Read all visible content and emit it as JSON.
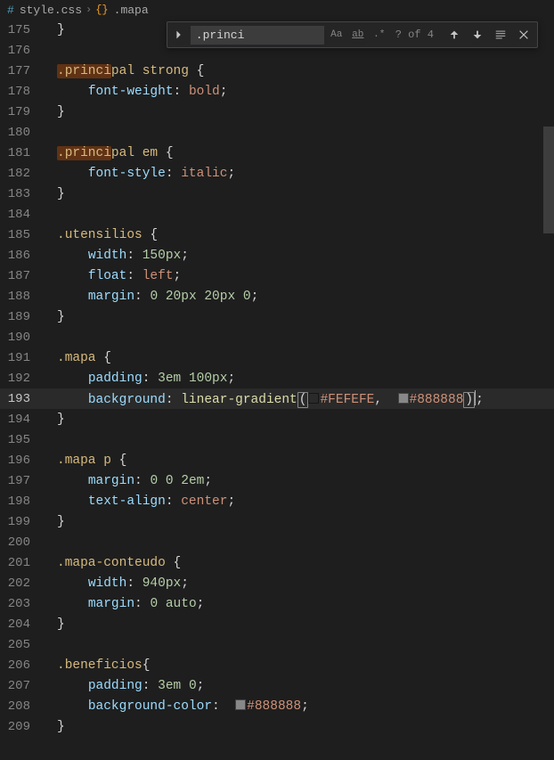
{
  "breadcrumbs": {
    "file_icon": "#",
    "file": "style.css",
    "symbol_icon": "{}",
    "symbol": ".mapa"
  },
  "find": {
    "value": ".princi",
    "opt_case": "Aa",
    "opt_word": "ab",
    "opt_regex": ".*",
    "count": "? of 4"
  },
  "gutter_start": 175,
  "code": {
    "l175": "}",
    "l177_sel_hl": ".princi",
    "l177_sel_rest": "pal",
    "l177_kw": "strong",
    "l177_brace": " {",
    "l178_prop": "font-weight",
    "l178_val": "bold",
    "l179": "}",
    "l181_sel_hl": ".princi",
    "l181_sel_rest": "pal",
    "l181_kw": "em",
    "l181_brace": " {",
    "l182_prop": "font-style",
    "l182_val": "italic",
    "l183": "}",
    "l185_sel": ".utensilios",
    "l185_brace": " {",
    "l186_prop": "width",
    "l186_val": "150px",
    "l187_prop": "float",
    "l187_val": "left",
    "l188_prop": "margin",
    "l188_v1": "0",
    "l188_v2": "20px",
    "l188_v3": "20px",
    "l188_v4": "0",
    "l189": "}",
    "l191_sel": ".mapa",
    "l191_brace": " {",
    "l192_prop": "padding",
    "l192_v1": "3em",
    "l192_v2": "100px",
    "l193_prop": "background",
    "l193_fn": "linear-gradient",
    "l193_c1": "#FEFEFE",
    "l193_c2": "#888888",
    "l194": "}",
    "l196_sel": ".mapa",
    "l196_kw": "p",
    "l196_brace": " {",
    "l197_prop": "margin",
    "l197_v1": "0",
    "l197_v2": "0",
    "l197_v3": "2em",
    "l198_prop": "text-align",
    "l198_val": "center",
    "l199": "}",
    "l201_sel": ".mapa-conteudo",
    "l201_brace": " {",
    "l202_prop": "width",
    "l202_val": "940px",
    "l203_prop": "margin",
    "l203_v1": "0",
    "l203_v2": "auto",
    "l204": "}",
    "l206_sel": ".beneficios",
    "l206_brace": "{",
    "l207_prop": "padding",
    "l207_v1": "3em",
    "l207_v2": "0",
    "l208_prop": "background-color",
    "l208_c": "#888888",
    "l209": "}"
  },
  "colors": {
    "c1": "#FEFEFE",
    "c2": "#888888",
    "c3": "#888888"
  }
}
